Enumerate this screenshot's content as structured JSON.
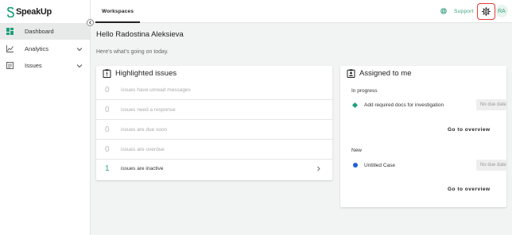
{
  "app": {
    "logo_text": "SpeakUp",
    "accent_color": "#3aa17e",
    "highlight_color": "#e53935"
  },
  "sidebar": {
    "collapse_icon": "chevron-left-icon",
    "items": [
      {
        "label": "Dashboard",
        "icon": "dashboard-icon",
        "active": true
      },
      {
        "label": "Analytics",
        "icon": "chart-icon",
        "expandable": true
      },
      {
        "label": "Issues",
        "icon": "issues-icon",
        "expandable": true
      }
    ]
  },
  "topbar": {
    "tab_label": "Workspaces",
    "support_label": "Support",
    "settings_icon": "gear-icon",
    "avatar_initials": "RA"
  },
  "main": {
    "greeting": "Hello Radostina Aleksieva",
    "subtitle": "Here's what's going on today."
  },
  "highlighted": {
    "title": "Highlighted issues",
    "rows": [
      {
        "count": "0",
        "text": "issues have unread messages"
      },
      {
        "count": "0",
        "text": "issues need a response"
      },
      {
        "count": "0",
        "text": "issues are due soon"
      },
      {
        "count": "0",
        "text": "issues are overdue"
      },
      {
        "count": "1",
        "text": "issues are inactive"
      }
    ]
  },
  "assigned": {
    "title": "Assigned to me",
    "sections": [
      {
        "label": "In progress",
        "case_name": "Add required docs for investigation",
        "due": "No due date",
        "overview": "Go to overview"
      },
      {
        "label": "New",
        "case_name": "Untitled Case",
        "due": "No due date",
        "overview": "Go to overview"
      }
    ]
  }
}
